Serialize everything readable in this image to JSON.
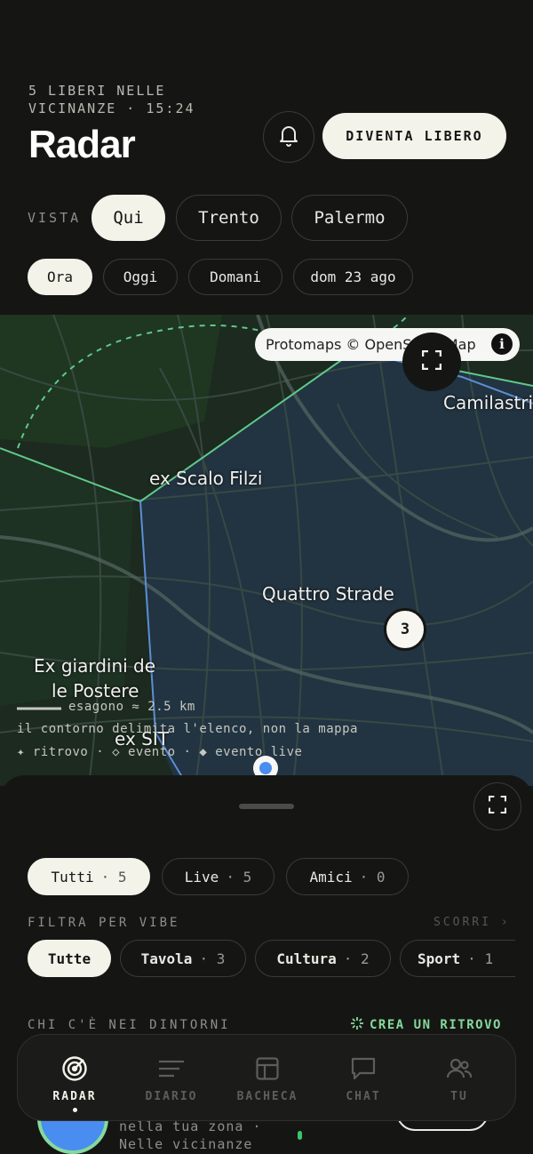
{
  "header": {
    "status_line": "5 LIBERI NELLE VICINANZE · 15:24",
    "title": "Radar",
    "cta_label": "DIVENTA LIBERO",
    "bell_icon": "bell-icon"
  },
  "vista": {
    "label": "VISTA",
    "options": [
      "Qui",
      "Trento",
      "Palermo"
    ],
    "selected": "Qui"
  },
  "time_filters": {
    "options": [
      "Ora",
      "Oggi",
      "Domani",
      "dom 23 ago"
    ],
    "selected": "Ora"
  },
  "map": {
    "attribution": "Protomaps © OpenStreetMap",
    "labels": [
      "Camilastri",
      "ex Scalo Filzi",
      "Quattro Strade",
      "Ex giardini de",
      "le Postere",
      "ex SIT"
    ],
    "cluster_count": "3",
    "scale_text": "esagono ≈ 2.5 km",
    "note": "il contorno delimita l'elenco, non la mappa",
    "legend": "✦ ritrovo · ◇ evento · ◆ evento live",
    "colors": {
      "hex_border": "#5fc98a",
      "hex_border_alt": "#5b8fd6",
      "hex_fill": "#24384a"
    }
  },
  "sheet": {
    "tabs": [
      {
        "label": "Tutti",
        "count": "· 5"
      },
      {
        "label": "Live",
        "count": "· 5"
      },
      {
        "label": "Amici",
        "count": "· 0"
      }
    ],
    "selected_tab": "Tutti",
    "vibe_label": "FILTRA PER VIBE",
    "scroll_hint": "SCORRI ›",
    "vibes": [
      {
        "label": "Tutte",
        "count": ""
      },
      {
        "label": "Tavola",
        "count": "· 3"
      },
      {
        "label": "Cultura",
        "count": "· 2"
      },
      {
        "label": "Sport",
        "count": "· 1"
      }
    ],
    "selected_vibe": "Tutte",
    "nearby_label": "CHI C'È NEI DINTORNI",
    "create_label": "CREA UN RITROVO",
    "peek_line1": "nella tua zona ·",
    "peek_line2": "Nelle vicinanze"
  },
  "nav": {
    "items": [
      {
        "label": "RADAR",
        "icon": "radar-icon"
      },
      {
        "label": "DIARIO",
        "icon": "list-icon"
      },
      {
        "label": "BACHECA",
        "icon": "board-icon"
      },
      {
        "label": "CHAT",
        "icon": "chat-icon"
      },
      {
        "label": "TU",
        "icon": "people-icon"
      }
    ],
    "active": "RADAR"
  }
}
